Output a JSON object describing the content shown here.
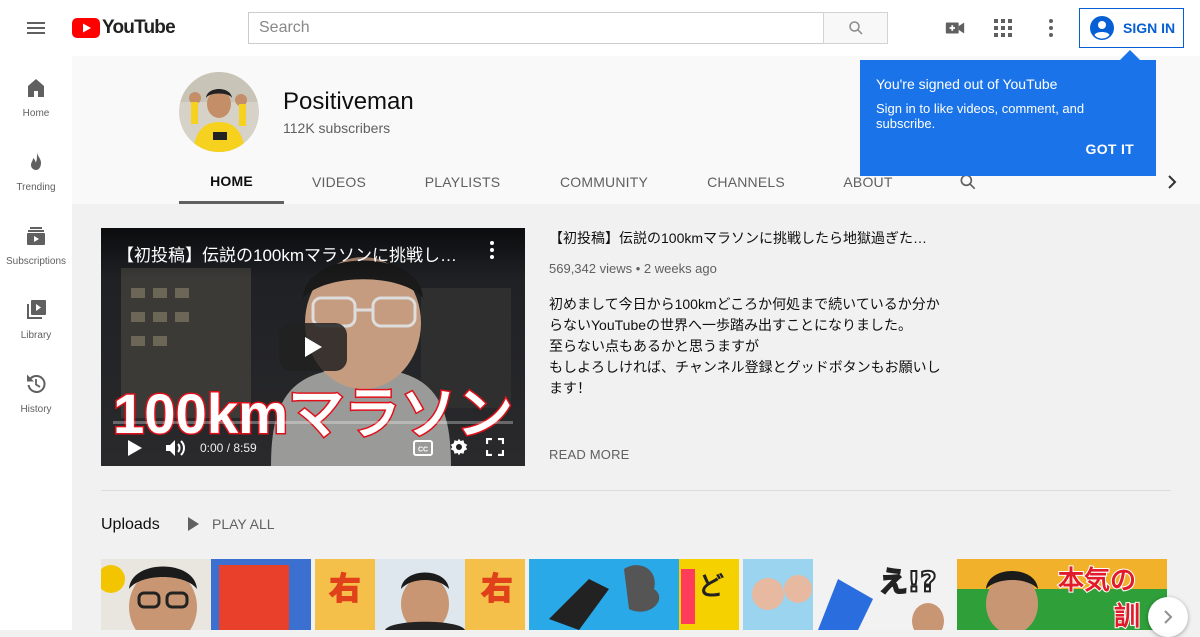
{
  "topbar": {
    "logo_text": "YouTube",
    "search_placeholder": "Search",
    "signin_label": "SIGN IN"
  },
  "sidenav": {
    "items": [
      {
        "label": "Home",
        "icon": "home-icon"
      },
      {
        "label": "Trending",
        "icon": "trending-icon"
      },
      {
        "label": "Subscriptions",
        "icon": "subscriptions-icon"
      },
      {
        "label": "Library",
        "icon": "library-icon"
      },
      {
        "label": "History",
        "icon": "history-icon"
      }
    ]
  },
  "channel": {
    "name": "Positiveman",
    "subscribers": "112K subscribers",
    "tabs": [
      "HOME",
      "VIDEOS",
      "PLAYLISTS",
      "COMMUNITY",
      "CHANNELS",
      "ABOUT"
    ],
    "active_tab": "HOME"
  },
  "popup": {
    "title": "You're signed out of YouTube",
    "message": "Sign in to like videos, comment, and subscribe.",
    "button": "GOT IT"
  },
  "featured": {
    "player_title": "【初投稿】伝説の100kmマラソンに挑戦し…",
    "thumbnail_text": "100kmマラソン",
    "time": "0:00 / 8:59",
    "title": "【初投稿】伝説の100kmマラソンに挑戦したら地獄過ぎた…",
    "meta": "569,342 views • 2 weeks ago",
    "description": [
      "初めまして今日から100kmどころか何処まで続いているか分か",
      "らないYouTubeの世界へ一歩踏み出すことになりました。",
      "至らない点もあるかと思うますが",
      "もしよろしければ、チャンネル登録とグッドボタンもお願いし",
      "ます！"
    ],
    "read_more": "READ MORE"
  },
  "uploads": {
    "title": "Uploads",
    "play_all": "PLAY ALL",
    "thumb_texts": [
      "",
      "右",
      "",
      "え!?",
      "本気の"
    ]
  },
  "colors": {
    "brand_red": "#ff0000",
    "accent_blue": "#065fd4",
    "popup_blue": "#1a73e8"
  }
}
